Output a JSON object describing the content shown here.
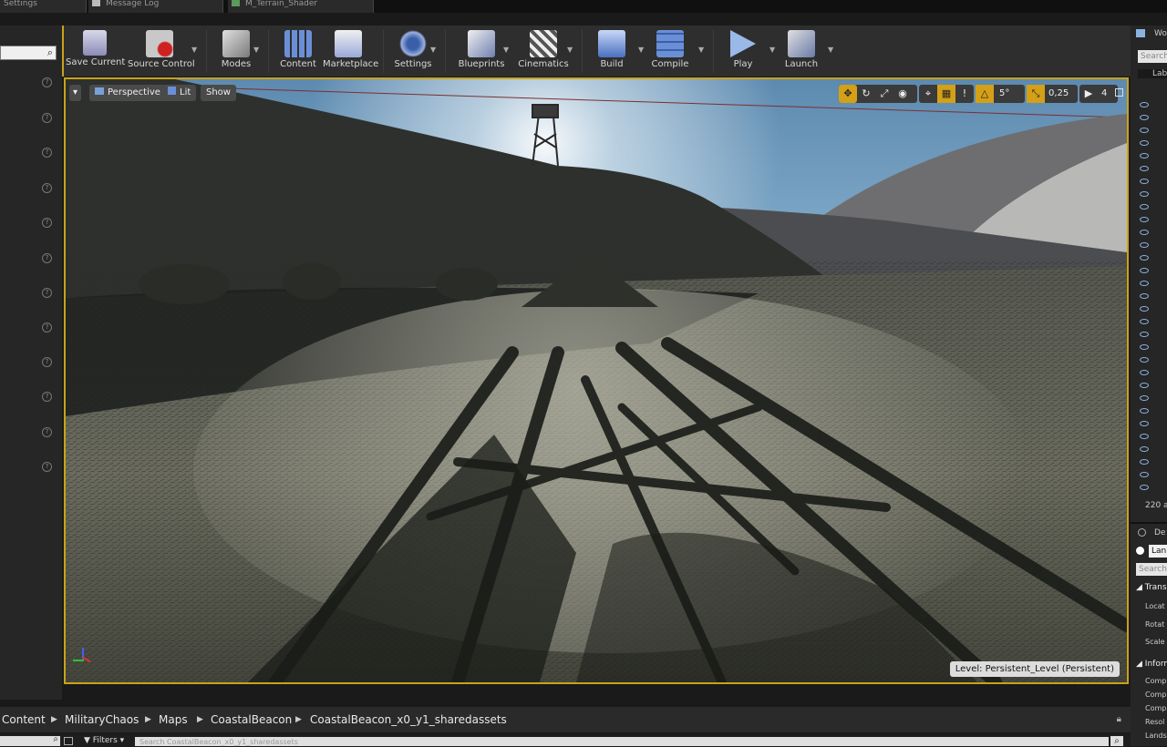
{
  "tabs": [
    {
      "label": "Settings"
    },
    {
      "label": "Message Log"
    },
    {
      "label": "M_Terrain_Shader"
    }
  ],
  "toolbar": {
    "buttons": [
      {
        "label": "Save Current",
        "icon": "save-icon"
      },
      {
        "label": "Source Control",
        "icon": "source-control-icon"
      },
      {
        "label": "Modes",
        "icon": "modes-icon"
      },
      {
        "label": "Content",
        "icon": "content-icon"
      },
      {
        "label": "Marketplace",
        "icon": "marketplace-icon"
      },
      {
        "label": "Settings",
        "icon": "settings-icon"
      },
      {
        "label": "Blueprints",
        "icon": "blueprints-icon"
      },
      {
        "label": "Cinematics",
        "icon": "cinematics-icon"
      },
      {
        "label": "Build",
        "icon": "build-icon"
      },
      {
        "label": "Compile",
        "icon": "compile-icon"
      },
      {
        "label": "Play",
        "icon": "play-icon"
      },
      {
        "label": "Launch",
        "icon": "launch-icon"
      }
    ]
  },
  "viewport": {
    "perspective_label": "Perspective",
    "lit_label": "Lit",
    "show_label": "Show",
    "rotation_snap": "5°",
    "scale_snap": "0,25",
    "camera_speed": "4",
    "level_label": "Level:  Persistent_Level (Persistent)"
  },
  "world_outliner": {
    "title": "Wo",
    "search_placeholder": "Search",
    "column": "Lab",
    "count": "220 a"
  },
  "details": {
    "title": "De",
    "actor_label": "Lan",
    "search_placeholder": "Search",
    "transform_title": "Trans",
    "rows": [
      "Locat",
      "Rotat",
      "Scale"
    ],
    "info_title": "Inform",
    "info_rows": [
      "Comp",
      "Comp",
      "Comp",
      "Resol",
      "Lands"
    ]
  },
  "content_browser": {
    "breadcrumb": [
      "Content",
      "MilitaryChaos",
      "Maps",
      "CoastalBeacon",
      "CoastalBeacon_x0_y1_sharedassets"
    ],
    "filters_label": "Filters",
    "search_placeholder": "Search CoastalBeacon_x0_y1_sharedassets"
  },
  "colors": {
    "accent_border": "#c9a21c",
    "snap_active": "#d4a017"
  }
}
